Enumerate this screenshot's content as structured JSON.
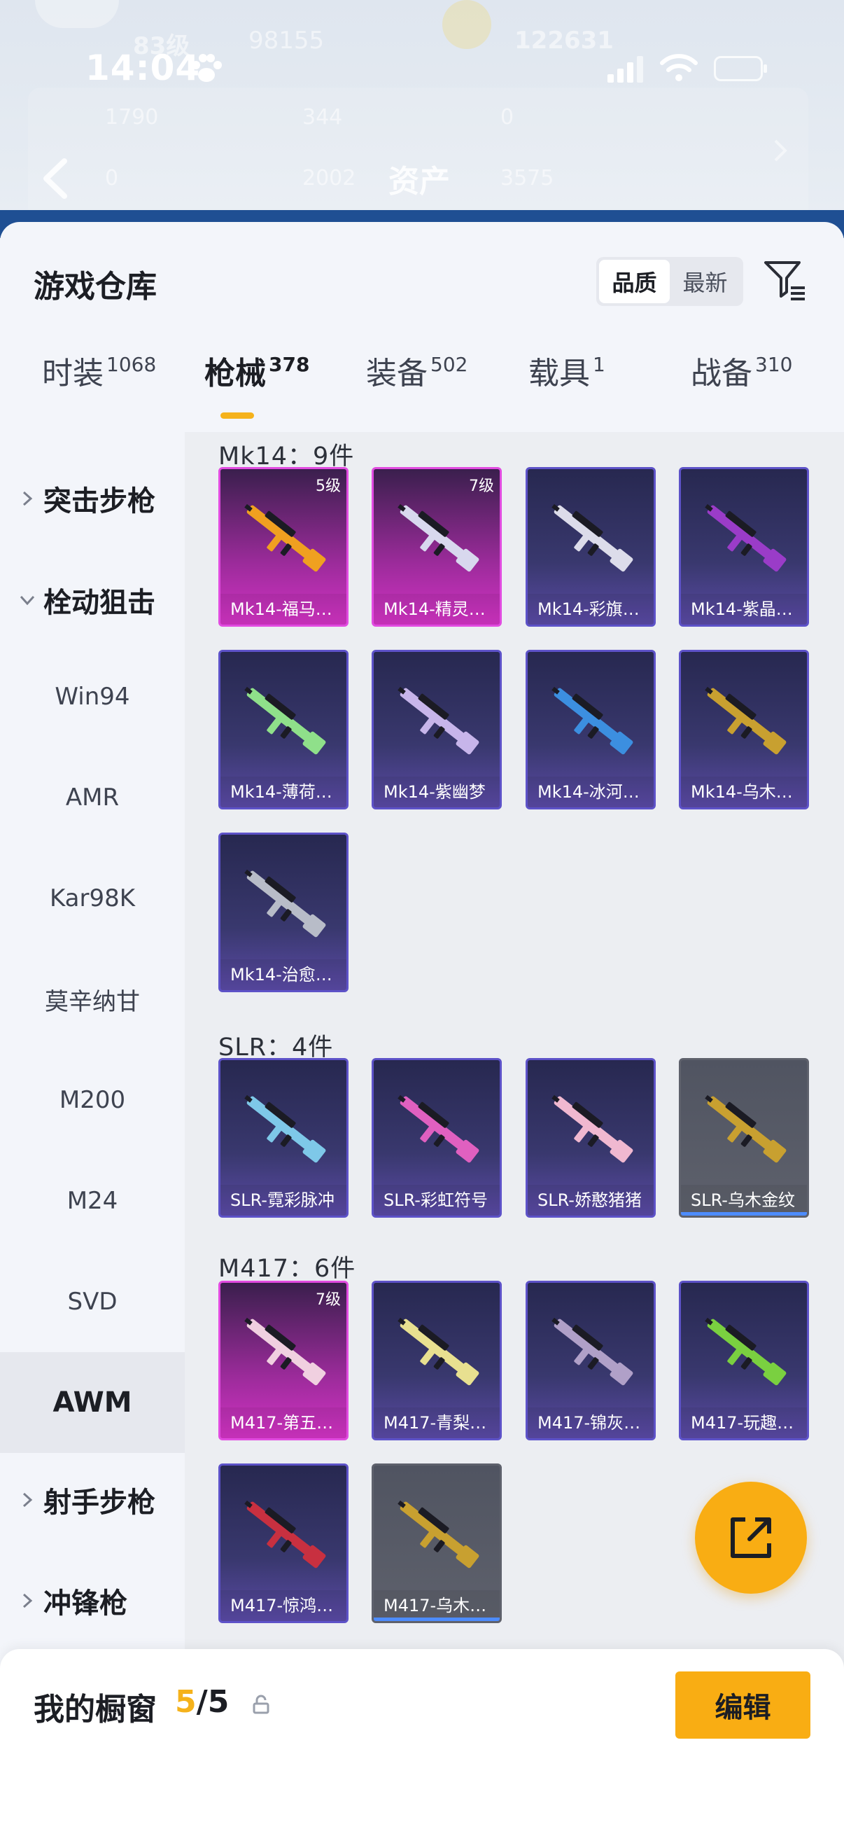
{
  "status_bar": {
    "time": "14:04"
  },
  "header_bg": {
    "level": "83级",
    "score_a": "98155",
    "score_b": "122631",
    "stats": [
      "1790",
      "344",
      "0",
      "0",
      "2002",
      "3575"
    ],
    "page_title": "资产"
  },
  "warehouse": {
    "title": "游戏仓库",
    "sort_options": [
      "品质",
      "最新"
    ],
    "active_sort": "品质"
  },
  "tabs": [
    {
      "label": "时装",
      "count": "1068"
    },
    {
      "label": "枪械",
      "count": "378",
      "active": true
    },
    {
      "label": "装备",
      "count": "502"
    },
    {
      "label": "载具",
      "count": "1"
    },
    {
      "label": "战备",
      "count": "310"
    }
  ],
  "categories": {
    "group_assault": "突击步枪",
    "group_sniper": "栓动狙击",
    "sniper_items": [
      "Win94",
      "AMR",
      "Kar98K",
      "莫辛纳甘",
      "M200",
      "M24",
      "SVD",
      "AWM"
    ],
    "active_item": "AWM",
    "group_marksman": "射手步枪",
    "group_smg": "冲锋枪"
  },
  "sections": [
    {
      "title": "Mk14：9件",
      "items": [
        {
          "name": "Mk14-福马…",
          "level": "5级",
          "rarity": "pink",
          "color": "#f0a020"
        },
        {
          "name": "Mk14-精灵…",
          "level": "7级",
          "rarity": "pink",
          "color": "#d8d8ee"
        },
        {
          "name": "Mk14-彩旗…",
          "rarity": "purple",
          "color": "#dcdcea"
        },
        {
          "name": "Mk14-紫晶…",
          "rarity": "purple",
          "color": "#9a3cc8"
        },
        {
          "name": "Mk14-薄荷…",
          "rarity": "purple",
          "color": "#8fe08a"
        },
        {
          "name": "Mk14-紫幽梦",
          "rarity": "purple",
          "color": "#c7b5ea"
        },
        {
          "name": "Mk14-冰河…",
          "rarity": "purple",
          "color": "#3c8fe0"
        },
        {
          "name": "Mk14-乌木…",
          "rarity": "purple",
          "color": "#c8a030"
        },
        {
          "name": "Mk14-治愈…",
          "rarity": "purple",
          "color": "#b8bcc8"
        }
      ]
    },
    {
      "title": "SLR：4件",
      "items": [
        {
          "name": "SLR-霓彩脉冲",
          "rarity": "purple",
          "color": "#7ec8e8"
        },
        {
          "name": "SLR-彩虹符号",
          "rarity": "purple",
          "color": "#e060c0"
        },
        {
          "name": "SLR-娇憨猪猪",
          "rarity": "purple",
          "color": "#f0b8d0"
        },
        {
          "name": "SLR-乌木金纹",
          "rarity": "gray",
          "color": "#c8a030"
        }
      ]
    },
    {
      "title": "M417：6件",
      "items": [
        {
          "name": "M417-第五…",
          "level": "7级",
          "rarity": "pink",
          "color": "#f0d0e0"
        },
        {
          "name": "M417-青梨…",
          "rarity": "purple",
          "color": "#e8e090"
        },
        {
          "name": "M417-锦灰…",
          "rarity": "purple",
          "color": "#b0a0c8"
        },
        {
          "name": "M417-玩趣…",
          "rarity": "purple",
          "color": "#7ad040"
        },
        {
          "name": "M417-惊鸿…",
          "rarity": "purple",
          "color": "#c83040"
        },
        {
          "name": "M417-乌木…",
          "rarity": "gray",
          "color": "#c8a030"
        }
      ]
    }
  ],
  "showcase": {
    "label": "我的橱窗",
    "current": "5",
    "total": "/5"
  },
  "edit_button": "编辑",
  "colors": {
    "accent": "#f9ad13",
    "pink_rarity": "#e14be0",
    "purple_rarity": "#5d52c8"
  }
}
